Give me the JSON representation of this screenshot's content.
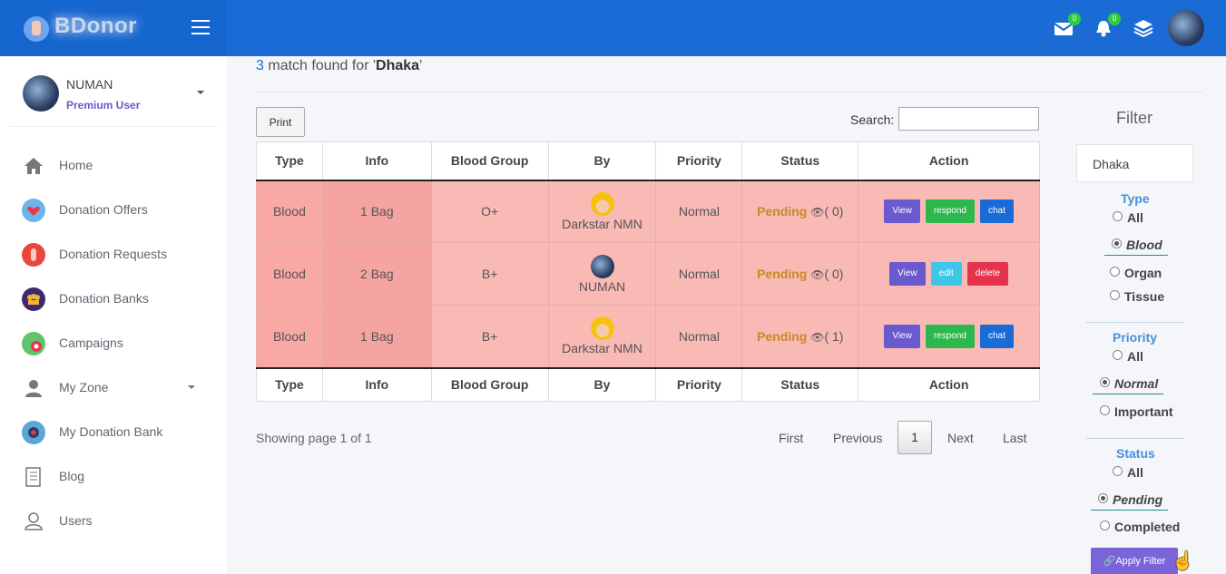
{
  "app": {
    "brand": "BDonor",
    "mail_count": "0",
    "notification_count": "0"
  },
  "user": {
    "name": "NUMAN",
    "role": "Premium User"
  },
  "sidebar": {
    "items": [
      {
        "label": "Home"
      },
      {
        "label": "Donation Offers"
      },
      {
        "label": "Donation Requests"
      },
      {
        "label": "Donation Banks"
      },
      {
        "label": "Campaigns"
      },
      {
        "label": "My Zone"
      },
      {
        "label": "My Donation Bank"
      },
      {
        "label": "Blog"
      },
      {
        "label": "Users"
      }
    ]
  },
  "results": {
    "count": "3",
    "prefix": "match found for '",
    "query": "Dhaka",
    "suffix": "'"
  },
  "toolbar": {
    "print_label": "Print",
    "search_label": "Search:",
    "search_value": ""
  },
  "table": {
    "columns": [
      "Type",
      "Info",
      "Blood Group",
      "By",
      "Priority",
      "Status",
      "Action"
    ],
    "rows": [
      {
        "type": "Blood",
        "info": "1 Bag",
        "blood_group": "O+",
        "by": "Darkstar NMN",
        "priority": "Normal",
        "status": "Pending",
        "views": "( 0)",
        "actions": [
          "View",
          "respond",
          "chat"
        ]
      },
      {
        "type": "Blood",
        "info": "2 Bag",
        "blood_group": "B+",
        "by": "NUMAN",
        "priority": "Normal",
        "status": "Pending",
        "views": "( 0)",
        "actions": [
          "View",
          "edit",
          "delete"
        ]
      },
      {
        "type": "Blood",
        "info": "1 Bag",
        "blood_group": "B+",
        "by": "Darkstar NMN",
        "priority": "Normal",
        "status": "Pending",
        "views": "( 1)",
        "actions": [
          "View",
          "respond",
          "chat"
        ]
      }
    ]
  },
  "pagination": {
    "info": "Showing page 1 of 1",
    "first": "First",
    "previous": "Previous",
    "current": "1",
    "next": "Next",
    "last": "Last"
  },
  "filter": {
    "title": "Filter",
    "location": "Dhaka",
    "type": {
      "title": "Type",
      "options": [
        "All",
        "Blood",
        "Organ",
        "Tissue"
      ],
      "selected": "Blood"
    },
    "priority": {
      "title": "Priority",
      "options": [
        "All",
        "Normal",
        "Important"
      ],
      "selected": "Normal"
    },
    "status": {
      "title": "Status",
      "options": [
        "All",
        "Pending",
        "Completed"
      ],
      "selected": "Pending"
    },
    "apply_label": "Apply Filter"
  }
}
